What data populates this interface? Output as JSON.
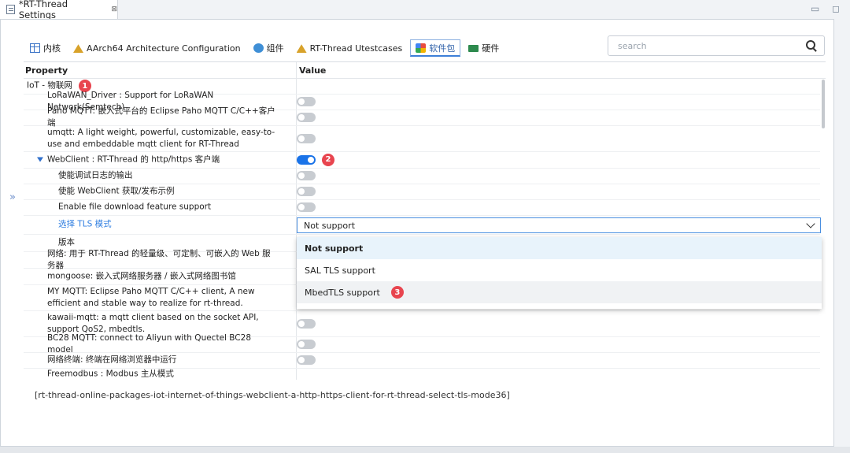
{
  "editor": {
    "tab_title": "*RT-Thread Settings",
    "close_glyph": "⊠"
  },
  "window_controls": "▭ ◻",
  "side_toggle": "»",
  "tabs": [
    {
      "label": "内核",
      "icon": "grid-icon",
      "active": false
    },
    {
      "label": "AArch64 Architecture Configuration",
      "icon": "chip-icon",
      "active": false
    },
    {
      "label": "组件",
      "icon": "cube-icon",
      "active": false
    },
    {
      "label": "RT-Thread Utestcases",
      "icon": "chip-icon",
      "active": false
    },
    {
      "label": "软件包",
      "icon": "puzzle-icon",
      "active": true
    },
    {
      "label": "硬件",
      "icon": "board-icon",
      "active": false
    }
  ],
  "search": {
    "placeholder": "search",
    "value": ""
  },
  "table": {
    "headers": {
      "property": "Property",
      "value": "Value"
    },
    "rows": [
      {
        "label": "IoT - 物联网",
        "indent": 0,
        "expand": true,
        "badge": "1"
      },
      {
        "label": "LoRaWAN_Driver : Support for LoRaWAN Network(Semtech)",
        "indent": 1,
        "toggle": "off"
      },
      {
        "label": "Paho MQTT: 嵌入式平台的 Eclipse Paho MQTT C/C++客户端",
        "indent": 1,
        "toggle": "off"
      },
      {
        "label": "umqtt: A light weight, powerful, customizable, easy-to-use and embeddable mqtt client for RT-Thread",
        "indent": 1,
        "toggle": "off"
      },
      {
        "label": "WebClient : RT-Thread 的 http/https 客户端",
        "indent": 1,
        "expand": true,
        "toggle": "on",
        "badge": "2"
      },
      {
        "label": "使能调试日志的输出",
        "indent": 2,
        "toggle": "off"
      },
      {
        "label": "使能 WebClient 获取/发布示例",
        "indent": 2,
        "toggle": "off"
      },
      {
        "label": "Enable file download feature support",
        "indent": 2,
        "toggle": "off"
      },
      {
        "label": "选择 TLS 模式",
        "indent": 2,
        "select": true
      },
      {
        "label": "版本",
        "indent": 2
      },
      {
        "label": "网络: 用于 RT-Thread 的轻量级、可定制、可嵌入的 Web 服务器",
        "indent": 1
      },
      {
        "label": "mongoose: 嵌入式网络服务器 / 嵌入式网络图书馆",
        "indent": 1
      },
      {
        "label": "MY MQTT: Eclipse Paho MQTT C/C++ client, A new efficient and stable way to realize for rt-thread.",
        "indent": 1
      },
      {
        "label": "kawaii-mqtt: a mqtt client based on the socket API, support QoS2, mbedtls.",
        "indent": 1,
        "toggle": "off"
      },
      {
        "label": "BC28 MQTT: connect to Aliyun with Quectel BC28 model",
        "indent": 1,
        "toggle": "off"
      },
      {
        "label": "网络终端: 终端在网络浏览器中运行",
        "indent": 1,
        "toggle": "off"
      },
      {
        "label": "Freemodbus : Modbus 主从模式",
        "indent": 1
      }
    ]
  },
  "tls_select": {
    "value": "Not support",
    "options": [
      {
        "label": "Not support",
        "state": "selected"
      },
      {
        "label": "SAL TLS support",
        "state": ""
      },
      {
        "label": "MbedTLS support",
        "state": "hover",
        "badge": "3"
      }
    ]
  },
  "description": "[rt-thread-online-packages-iot-internet-of-things-webclient-a-http-https-client-for-rt-thread-select-tls-mode36]"
}
